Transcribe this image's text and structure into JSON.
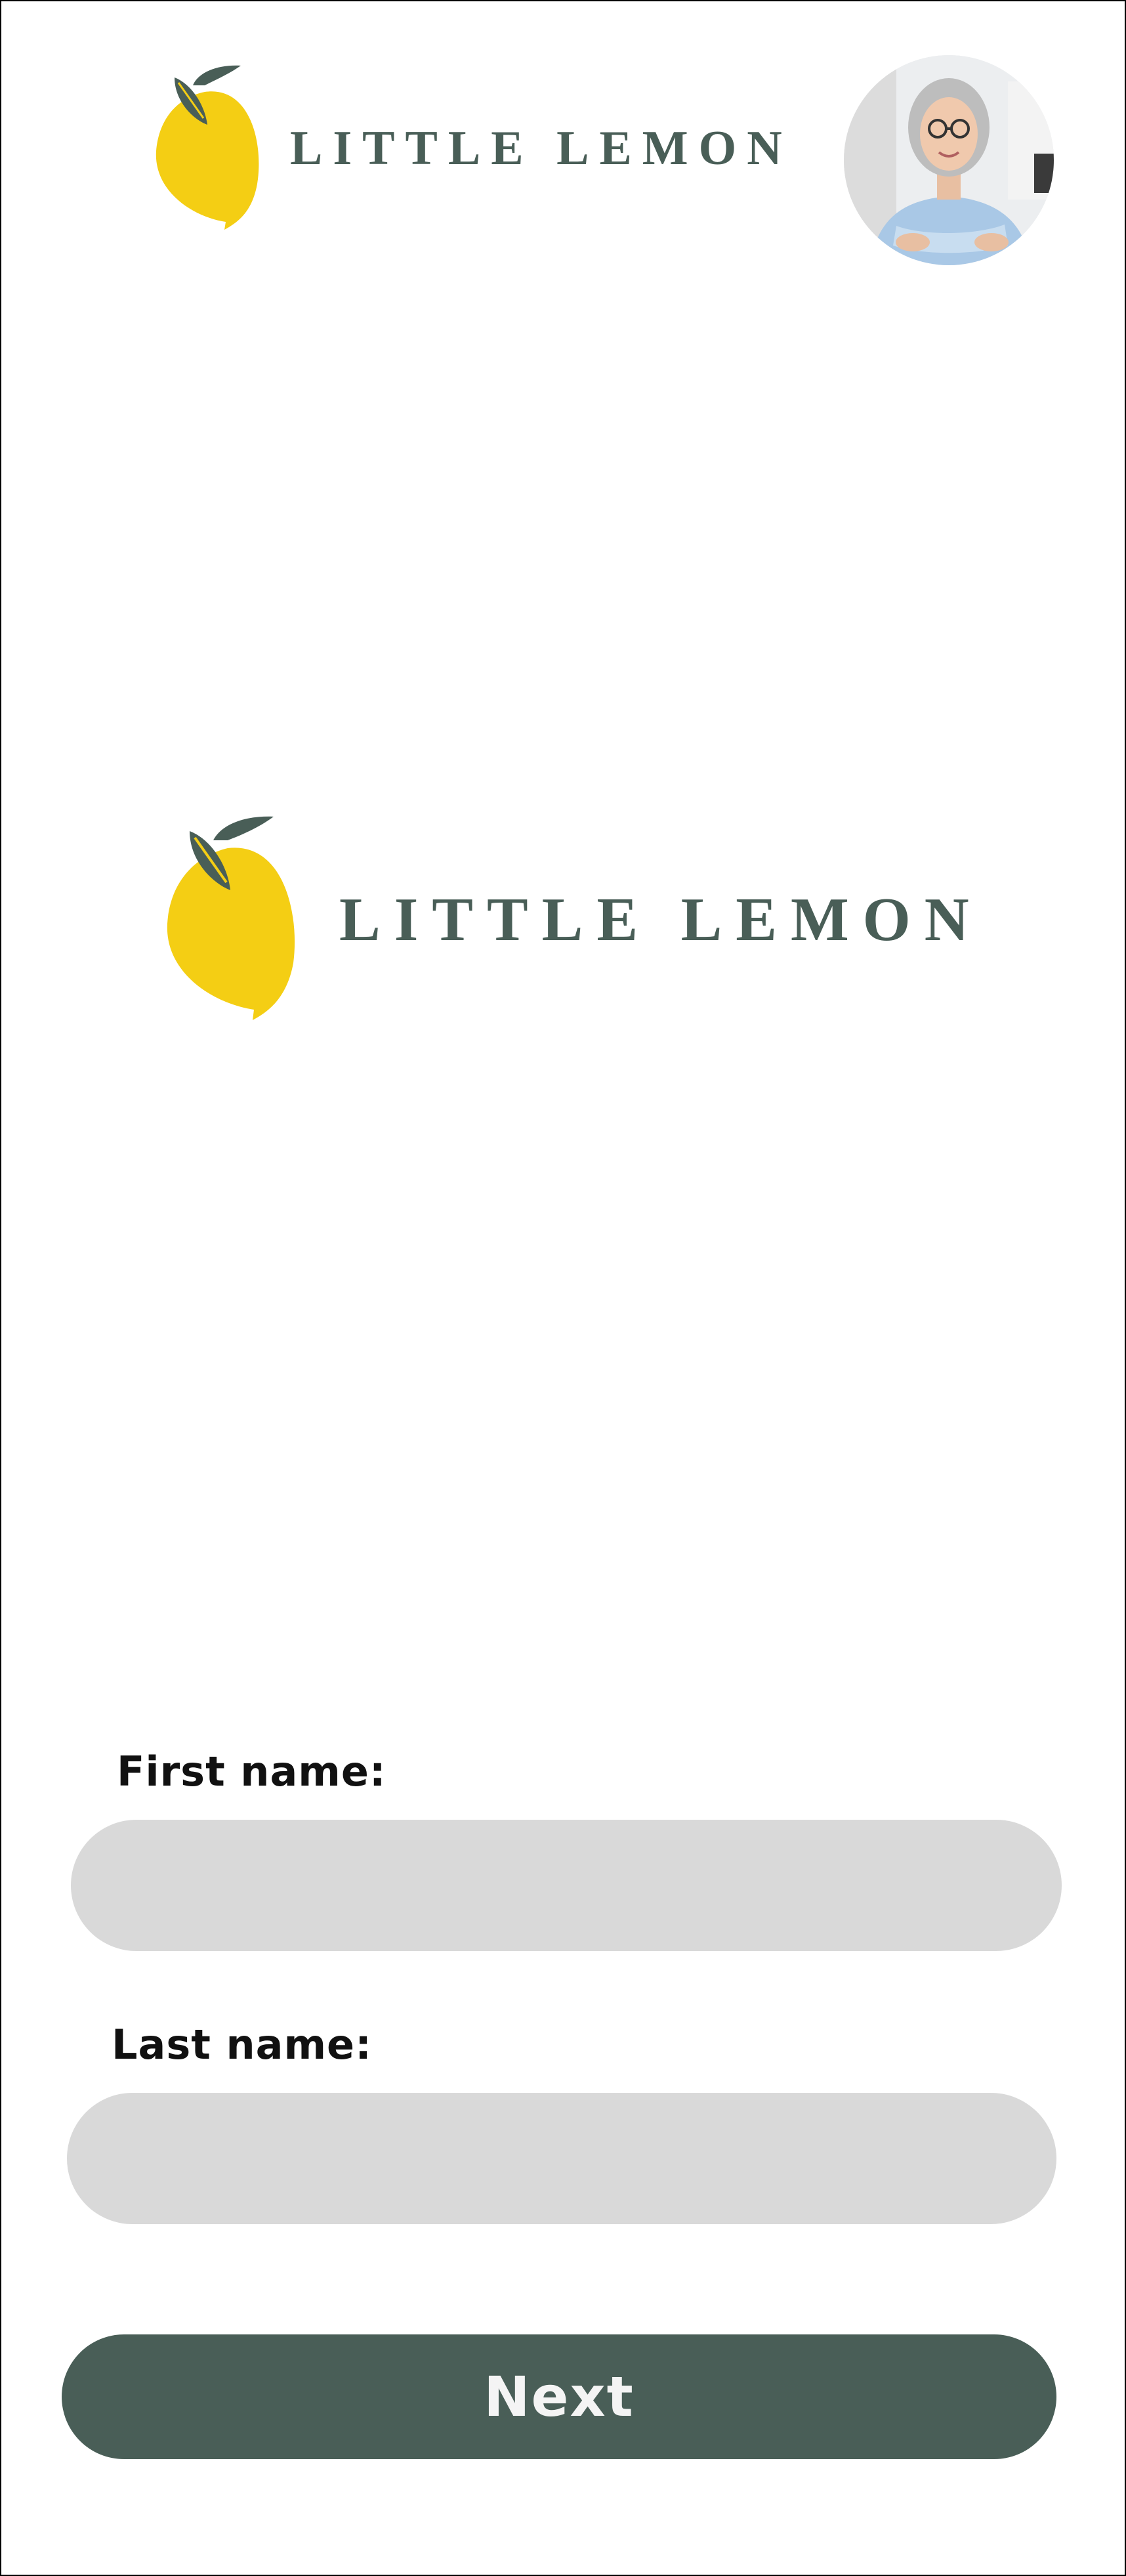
{
  "header": {
    "logo": {
      "text": "LITTLE LEMON",
      "icon": "lemon-icon"
    },
    "avatar": {
      "icon": "user-avatar-photo"
    }
  },
  "hero": {
    "logo": {
      "text": "LITTLE LEMON",
      "icon": "lemon-icon"
    }
  },
  "form": {
    "first_name": {
      "label": "First name:",
      "value": ""
    },
    "last_name": {
      "label": "Last name:",
      "value": ""
    },
    "next_label": "Next"
  },
  "colors": {
    "brand_green": "#495e57",
    "lemon_yellow": "#f4ce14",
    "input_bg": "#d9d9d9",
    "logo_text": "#495e57"
  }
}
